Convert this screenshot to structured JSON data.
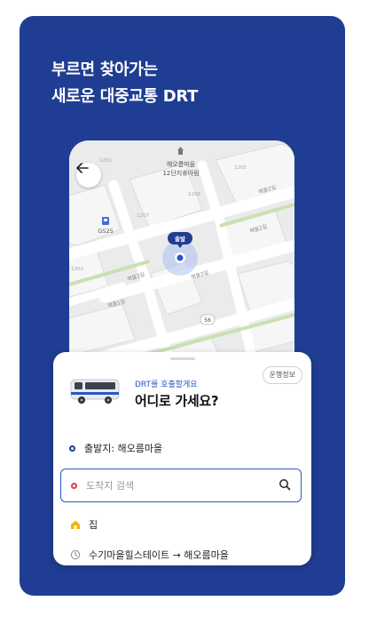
{
  "headline": {
    "line1": "부르면 찾아가는",
    "line2": "새로운 대중교통 DRT"
  },
  "map": {
    "poi_name": "해오름마을",
    "poi_sub": "12단지휴아림",
    "gas_station": "GS25",
    "pickup_marker": "출발",
    "route_badge": "56",
    "road_labels": [
      "해올2길",
      "해올2길",
      "해올2길",
      "해올1길",
      "해올2길"
    ],
    "building_numbers": [
      "1201",
      "1205",
      "1206",
      "1207",
      "1202"
    ]
  },
  "sheet": {
    "info_chip": "운행정보",
    "prompt_sub": "DRT를 호출할게요",
    "prompt_title": "어디로 가세요?",
    "origin_label": "출발지: 해오름마을",
    "destination_placeholder": "도착지 검색",
    "saved_home": "집",
    "recent_route": "수기마을힐스테이트 → 해오름마을"
  },
  "colors": {
    "brand": "#1f3d92",
    "accent": "#2a56c6",
    "dest_dot": "#e53950",
    "home_icon": "#f5b400"
  }
}
